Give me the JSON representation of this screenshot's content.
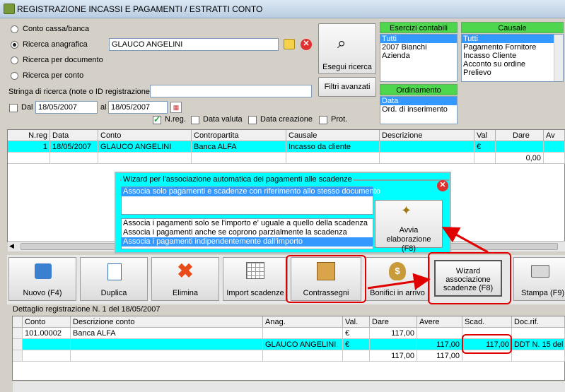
{
  "window": {
    "title": "REGISTRAZIONE INCASSI E PAGAMENTI / ESTRATTI CONTO"
  },
  "search": {
    "radio_cassa": "Conto cassa/banca",
    "radio_anagrafica": "Ricerca anagrafica",
    "anagrafica_value": "GLAUCO ANGELINI",
    "radio_documento": "Ricerca per documento",
    "radio_conto": "Ricerca per conto",
    "stringa_label": "Stringa di ricerca (note o ID registrazione)",
    "stringa_value": "",
    "dal_label": "Dal",
    "dal_value": "18/05/2007",
    "al_label": "al",
    "al_value": "18/05/2007",
    "nreg_label": "N.reg.",
    "data_valuta_label": "Data valuta",
    "data_creazione_label": "Data creazione",
    "prot_label": "Prot.",
    "esegui_label": "Esegui ricerca",
    "filtri_label": "Filtri avanzati"
  },
  "esercizi": {
    "header": "Esercizi contabili",
    "items": [
      "Tutti",
      "2007 Bianchi",
      "Azienda"
    ]
  },
  "ordinamento": {
    "header": "Ordinamento",
    "items": [
      "Data",
      "Ord. di inserimento"
    ]
  },
  "causale": {
    "header": "Causale",
    "items": [
      "Tutti",
      "Pagamento Fornitore",
      "Incasso Cliente",
      "Acconto su ordine",
      "Prelievo"
    ]
  },
  "main_grid": {
    "headers": [
      "N.reg",
      "Data",
      "Conto",
      "Contropartita",
      "Causale",
      "Descrizione",
      "Val",
      "Dare",
      "Av"
    ],
    "row1": [
      "1",
      "18/05/2007",
      "GLAUCO ANGELINI",
      "Banca ALFA",
      "Incasso da cliente",
      "",
      "€",
      "",
      ""
    ],
    "row2": [
      "",
      "",
      "",
      "",
      "",
      "",
      "",
      "0,00",
      ""
    ]
  },
  "wizard": {
    "title": "Wizard per l'associazione automatica dei pagamenti alle scadenze",
    "opt1": "Associa solo pagamenti e scadenze con riferimento allo stesso documento",
    "opt2": "Associa i pagamenti solo se l'importo e' uguale a quello della scadenza",
    "opt3": "Associa i pagamenti anche se coprono parzialmente la scadenza",
    "opt4": "Associa i pagamenti indipendentemente dall'importo",
    "avvia_label": "Avvia elaborazione (F8)"
  },
  "toolbar": {
    "nuovo": "Nuovo (F4)",
    "duplica": "Duplica",
    "elimina": "Elimina",
    "import": "Import scadenze",
    "contrassegni": "Contrassegni",
    "bonifici": "Bonifici in arrivo",
    "wizard": "Wizard associazione scadenze (F8)",
    "stampa": "Stampa (F9)"
  },
  "detail": {
    "title": "Dettaglio registrazione N. 1 del 18/05/2007",
    "headers": [
      "Conto",
      "Descrizione conto",
      "Anag.",
      "Val.",
      "Dare",
      "Avere",
      "Scad.",
      "Doc.rif."
    ],
    "row1": [
      "101.00002",
      "Banca ALFA",
      "",
      "€",
      "117,00",
      "",
      "",
      ""
    ],
    "row2": [
      "",
      "",
      "GLAUCO ANGELINI",
      "€",
      "",
      "117,00",
      "117,00",
      "DDT N. 15 del"
    ],
    "row3": [
      "",
      "",
      "",
      "",
      "117,00",
      "117,00",
      "",
      ""
    ]
  },
  "colors": {
    "accent": "#00ffff",
    "highlight": "#3399ff",
    "annotation": "#e00000",
    "header_green": "#4fd64f"
  }
}
